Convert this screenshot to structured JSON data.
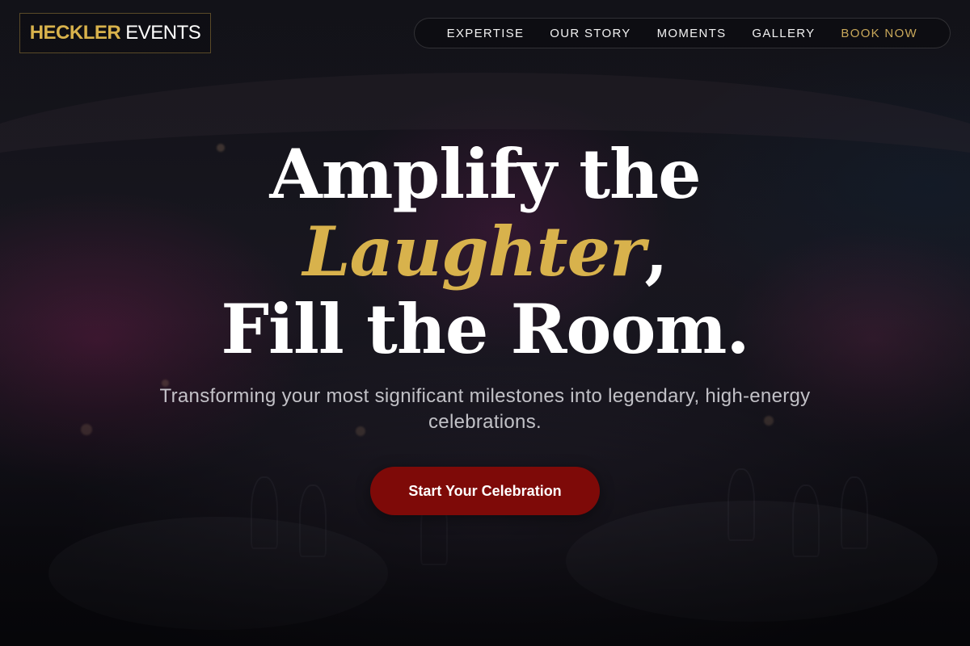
{
  "brand": {
    "part1": "HECKLER",
    "part2": "EVENTS"
  },
  "nav": {
    "items": [
      {
        "label": "EXPERTISE"
      },
      {
        "label": "OUR STORY"
      },
      {
        "label": "MOMENTS"
      },
      {
        "label": "GALLERY"
      },
      {
        "label": "BOOK NOW"
      }
    ]
  },
  "hero": {
    "line1": "Amplify the",
    "line2_highlight": "Laughter",
    "line2_suffix": ",",
    "line3": "Fill the Room.",
    "subtitle": "Transforming your most significant milestones into legendary, high-energy celebrations.",
    "cta_label": "Start Your Celebration"
  },
  "colors": {
    "gold_accent": "#d8b24c",
    "cta_red": "#7e0a08",
    "nav_accent": "#c9a85a"
  }
}
